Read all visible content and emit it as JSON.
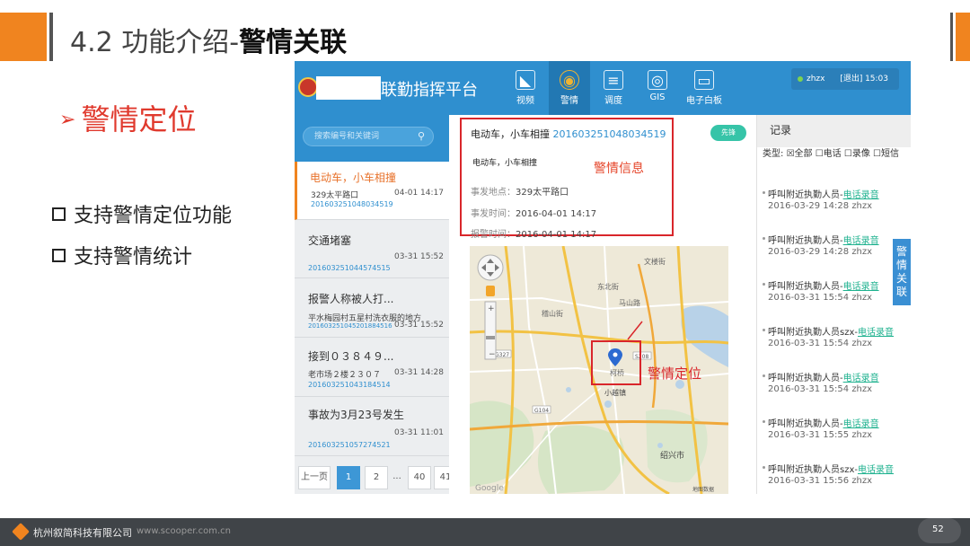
{
  "slide": {
    "title_prefix": "4.2 功能介绍-",
    "title_bold": "警情关联",
    "section_heading": "警情定位",
    "bullets": [
      "支持警情定位功能",
      "支持警情统计"
    ],
    "footer_company": "杭州叙简科技有限公司",
    "footer_url": "www.scooper.com.cn",
    "page_number": "52"
  },
  "app": {
    "name": "联勤指挥平台",
    "nav": [
      {
        "label": "视频",
        "icon": "video-camera-icon"
      },
      {
        "label": "警情",
        "icon": "alarm-icon"
      },
      {
        "label": "调度",
        "icon": "dispatch-icon"
      },
      {
        "label": "GIS",
        "icon": "gis-pin-icon"
      },
      {
        "label": "电子白板",
        "icon": "whiteboard-icon"
      }
    ],
    "user": "zhzx",
    "logout": "[退出]",
    "clock": "15:03",
    "search_placeholder": "搜索编号和关键词",
    "incidents": [
      {
        "title": "电动车，小车相撞",
        "address": "329太平路口",
        "datetime": "04-01 14:17",
        "number": "201603251048034519"
      },
      {
        "title": "交通堵塞",
        "address": "",
        "datetime": "03-31 15:52",
        "number": "201603251044574515"
      },
      {
        "title": "报警人称被人打...",
        "address": "平水梅园村五星村洗衣服的地方",
        "datetime": "03-31 15:52",
        "number": "201603251045201884516"
      },
      {
        "title": "接到０３８４９...",
        "address": "老市场２楼２３０７",
        "datetime": "03-31 14:28",
        "number": "201603251043184514"
      },
      {
        "title": "事故为3月23号发生",
        "address": "",
        "datetime": "03-31 11:01",
        "number": "201603251057274521"
      }
    ],
    "pagination": {
      "prev": "上一页",
      "pages": [
        "1",
        "2",
        "...",
        "40",
        "41"
      ],
      "current": "1"
    },
    "detail": {
      "title": "电动车，小车相撞",
      "number": "201603251048034519",
      "summary": "电动车，小车相撞",
      "annotation": "警情信息",
      "location_label": "事发地点：",
      "location": "329太平路口",
      "occur_label": "事发时间：",
      "occur_time": "2016-04-01 14:17",
      "report_label": "报警时间：",
      "report_time": "2016-04-01 14:17",
      "dispatch_button": "先锋"
    },
    "map": {
      "annotation": "警情定位",
      "place_labels": [
        "文楼街",
        "东北街",
        "马山路",
        "稽山街",
        "小越镇",
        "柯桥",
        "绍兴市"
      ],
      "road_numbers": [
        "G327",
        "S208",
        "G104"
      ],
      "attribution": "Google",
      "copyright": "地图数据"
    },
    "records": {
      "title": "记录",
      "filter_label": "类型:",
      "filters": [
        "☒全部",
        "☐电话",
        "☐录像",
        "☐短信"
      ],
      "items": [
        {
          "caller": "呼叫附近执勤人员-",
          "link": "电话录音",
          "time": "2016-03-29 14:28",
          "user": "zhzx"
        },
        {
          "caller": "呼叫附近执勤人员-",
          "link": "电话录音",
          "time": "2016-03-29 14:28",
          "user": "zhzx"
        },
        {
          "caller": "呼叫附近执勤人员-",
          "link": "电话录音",
          "time": "2016-03-31 15:54",
          "user": "zhzx"
        },
        {
          "caller": "呼叫附近执勤人员szx-",
          "link": "电话录音",
          "time": "2016-03-31 15:54",
          "user": "zhzx"
        },
        {
          "caller": "呼叫附近执勤人员-",
          "link": "电话录音",
          "time": "2016-03-31 15:54",
          "user": "zhzx"
        },
        {
          "caller": "呼叫附近执勤人员-",
          "link": "电话录音",
          "time": "2016-03-31 15:55",
          "user": "zhzx"
        },
        {
          "caller": "呼叫附近执勤人员szx-",
          "link": "电话录音",
          "time": "2016-03-31 15:56",
          "user": "zhzx"
        }
      ]
    },
    "side_tab": "警情关联"
  },
  "colors": {
    "accent_orange": "#f0841f",
    "header_blue": "#2f8fcf",
    "alert_red": "#d9262b",
    "link_green": "#1fb28f"
  }
}
